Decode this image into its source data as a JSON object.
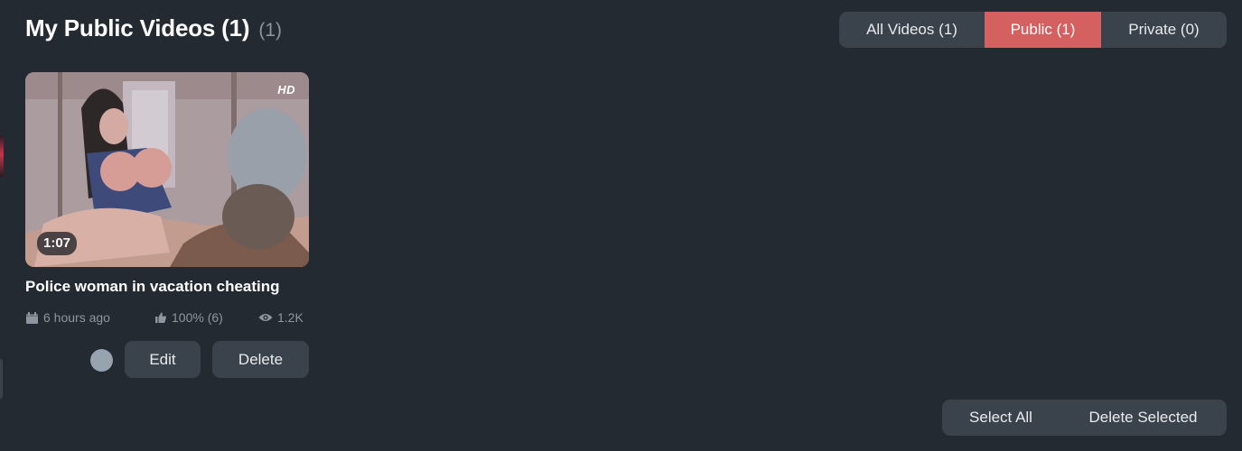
{
  "header": {
    "title": "My Public Videos (1)",
    "count": "(1)"
  },
  "filters": [
    {
      "label": "All Videos (1)",
      "active": false
    },
    {
      "label": "Public (1)",
      "active": true
    },
    {
      "label": "Private (0)",
      "active": false
    }
  ],
  "video": {
    "hd_badge": "HD",
    "duration": "1:07",
    "title": "Police woman in vacation cheating",
    "posted": "6 hours ago",
    "rating": "100% (6)",
    "views": "1.2K",
    "edit_label": "Edit",
    "delete_label": "Delete"
  },
  "bulk_actions": {
    "select_all": "Select All",
    "delete_selected": "Delete Selected"
  },
  "colors": {
    "background": "#242a31",
    "active_tab": "#d4605f",
    "button": "#3a434c",
    "muted_text": "#8d96a0"
  },
  "icons": {
    "date": "calendar-icon",
    "rating": "thumbs-up-icon",
    "views": "eye-icon"
  }
}
